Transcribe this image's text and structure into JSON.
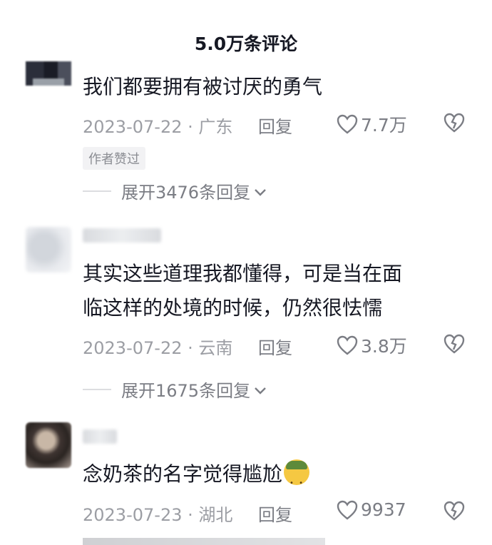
{
  "header": {
    "title": "5.0万条评论"
  },
  "comments": [
    {
      "text": "我们都要拥有被讨厌的勇气",
      "meta": "2023-07-22 · 广东",
      "reply": "回复",
      "likes": "7.7万",
      "author_tag": "作者赞过",
      "expand": "展开3476条回复"
    },
    {
      "text_line1": "其实这些道理我都懂得，可是当在面",
      "text_line2": "临这样的处境的时候，仍然很怯懦",
      "meta": "2023-07-22 · 云南",
      "reply": "回复",
      "likes": "3.8万",
      "expand": "展开1675条回复"
    },
    {
      "text": "念奶茶的名字觉得尴尬",
      "meta": "2023-07-23 · 湖北",
      "reply": "回复",
      "likes": "9937"
    }
  ],
  "icons": {
    "like": "heart-outline-icon",
    "dislike": "broken-heart-icon",
    "expand": "chevron-down-icon"
  },
  "colors": {
    "text": "#161823",
    "meta": "#9c9ea4",
    "action": "#7b7d84"
  }
}
